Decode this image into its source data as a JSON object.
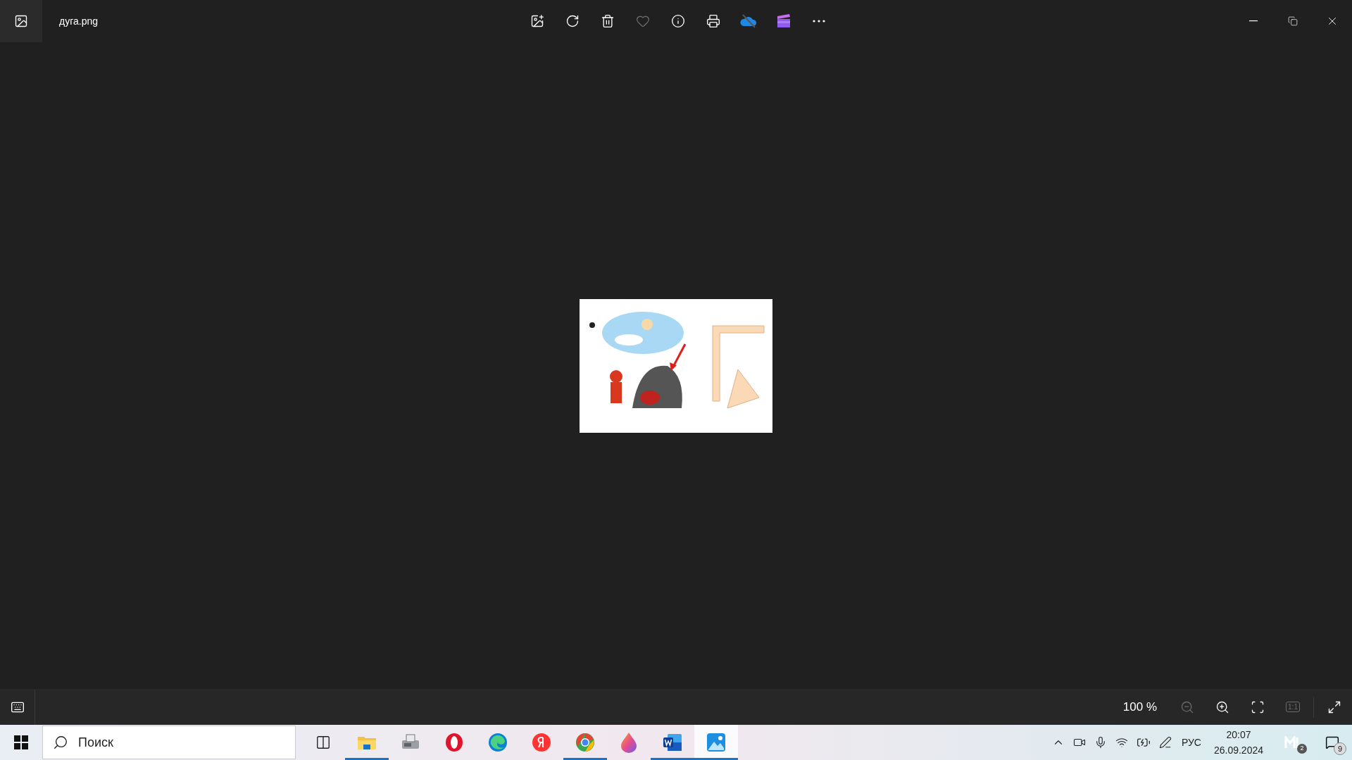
{
  "window": {
    "title": "дуга.png"
  },
  "toolbar": [
    {
      "kind": "edit",
      "disabled": false
    },
    {
      "kind": "rotate",
      "disabled": false
    },
    {
      "kind": "delete",
      "disabled": false
    },
    {
      "kind": "favorite",
      "disabled": true
    },
    {
      "kind": "info",
      "disabled": false
    },
    {
      "kind": "print",
      "disabled": false
    },
    {
      "kind": "cloud",
      "disabled": false
    },
    {
      "kind": "video",
      "disabled": false
    },
    {
      "kind": "more",
      "disabled": false
    }
  ],
  "zoom_bar": {
    "zoom_level": "100 %",
    "buttons": [
      {
        "kind": "zoom-out",
        "disabled": true
      },
      {
        "kind": "zoom-in",
        "disabled": false
      },
      {
        "kind": "fit",
        "disabled": false
      },
      {
        "kind": "actual-size",
        "label": "1:1",
        "disabled": true
      }
    ]
  },
  "taskbar": {
    "search": {
      "placeholder": "Поиск"
    },
    "apps": [
      {
        "kind": "task-view",
        "running": false,
        "selected": false
      },
      {
        "kind": "folder",
        "running": true,
        "selected": false
      },
      {
        "kind": "fax",
        "running": false,
        "selected": false
      },
      {
        "kind": "opera",
        "running": false,
        "selected": false
      },
      {
        "kind": "edge",
        "running": false,
        "selected": false
      },
      {
        "kind": "yandex",
        "running": false,
        "selected": false
      },
      {
        "kind": "chrome",
        "running": true,
        "selected": false
      },
      {
        "kind": "drop",
        "running": false,
        "selected": false
      },
      {
        "kind": "word",
        "running": true,
        "selected": false
      },
      {
        "kind": "photos",
        "running": true,
        "selected": true
      }
    ],
    "language": "РУС",
    "time": "20:07",
    "date": "26.09.2024",
    "app_badge": "2",
    "notification_count": "9"
  }
}
